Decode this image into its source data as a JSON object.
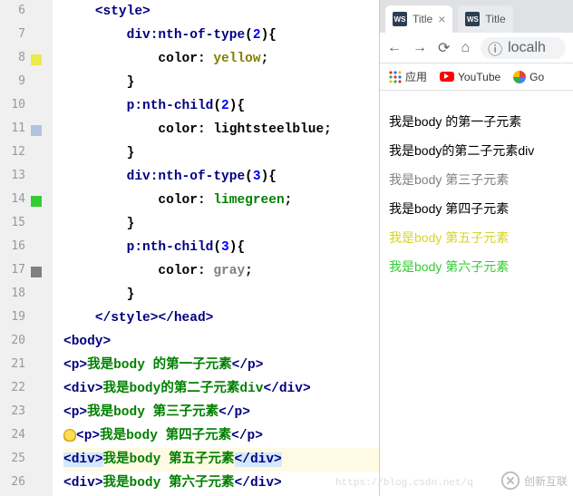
{
  "editor": {
    "line_numbers": [
      "6",
      "7",
      "8",
      "9",
      "10",
      "11",
      "12",
      "13",
      "14",
      "15",
      "16",
      "17",
      "18",
      "19",
      "20",
      "21",
      "22",
      "23",
      "24",
      "25",
      "26"
    ],
    "gutter_marks": [
      {
        "line": "8",
        "color": "#eaea4a"
      },
      {
        "line": "11",
        "color": "#b0c4de"
      },
      {
        "line": "14",
        "color": "#32cd32"
      },
      {
        "line": "17",
        "color": "#808080"
      }
    ],
    "lines": {
      "6": {
        "indent": 2,
        "tokens": [
          {
            "t": "<",
            "c": "tag"
          },
          {
            "t": "style",
            "c": "tag"
          },
          {
            "t": ">",
            "c": "tag"
          }
        ]
      },
      "7": {
        "indent": 4,
        "tokens": [
          {
            "t": "div:nth-of-type",
            "c": "sel"
          },
          {
            "t": "(",
            "c": "punct"
          },
          {
            "t": "2",
            "c": "num"
          },
          {
            "t": ")",
            "c": "punct"
          },
          {
            "t": "{",
            "c": "punct"
          }
        ]
      },
      "8": {
        "indent": 6,
        "tokens": [
          {
            "t": "color",
            "c": "prop"
          },
          {
            "t": ": ",
            "c": "punct"
          },
          {
            "t": "yellow",
            "c": "val-yellow"
          },
          {
            "t": ";",
            "c": "punct"
          }
        ]
      },
      "9": {
        "indent": 4,
        "tokens": [
          {
            "t": "}",
            "c": "punct"
          }
        ]
      },
      "10": {
        "indent": 4,
        "tokens": [
          {
            "t": "p:nth-child",
            "c": "sel"
          },
          {
            "t": "(",
            "c": "punct"
          },
          {
            "t": "2",
            "c": "num"
          },
          {
            "t": ")",
            "c": "punct"
          },
          {
            "t": "{",
            "c": "punct"
          }
        ]
      },
      "11": {
        "indent": 6,
        "tokens": [
          {
            "t": "color",
            "c": "prop"
          },
          {
            "t": ": ",
            "c": "punct"
          },
          {
            "t": "lightsteelblue",
            "c": "val-lsb"
          },
          {
            "t": ";",
            "c": "punct"
          }
        ]
      },
      "12": {
        "indent": 4,
        "tokens": [
          {
            "t": "}",
            "c": "punct"
          }
        ]
      },
      "13": {
        "indent": 4,
        "tokens": [
          {
            "t": "div:nth-of-type",
            "c": "sel"
          },
          {
            "t": "(",
            "c": "punct"
          },
          {
            "t": "3",
            "c": "num"
          },
          {
            "t": ")",
            "c": "punct"
          },
          {
            "t": "{",
            "c": "punct"
          }
        ]
      },
      "14": {
        "indent": 6,
        "tokens": [
          {
            "t": "color",
            "c": "prop"
          },
          {
            "t": ": ",
            "c": "punct"
          },
          {
            "t": "limegreen",
            "c": "val-lime"
          },
          {
            "t": ";",
            "c": "punct"
          }
        ]
      },
      "15": {
        "indent": 4,
        "tokens": [
          {
            "t": "}",
            "c": "punct"
          }
        ]
      },
      "16": {
        "indent": 4,
        "tokens": [
          {
            "t": "p:nth-child",
            "c": "sel"
          },
          {
            "t": "(",
            "c": "punct"
          },
          {
            "t": "3",
            "c": "num"
          },
          {
            "t": ")",
            "c": "punct"
          },
          {
            "t": "{",
            "c": "punct"
          }
        ]
      },
      "17": {
        "indent": 6,
        "tokens": [
          {
            "t": "color",
            "c": "prop"
          },
          {
            "t": ": ",
            "c": "punct"
          },
          {
            "t": "gray",
            "c": "val-gray"
          },
          {
            "t": ";",
            "c": "punct"
          }
        ]
      },
      "18": {
        "indent": 4,
        "tokens": [
          {
            "t": "}",
            "c": "punct"
          }
        ]
      },
      "19": {
        "indent": 2,
        "tokens": [
          {
            "t": "</",
            "c": "tag"
          },
          {
            "t": "style",
            "c": "tag"
          },
          {
            "t": ">",
            "c": "tag"
          },
          {
            "t": "</",
            "c": "tag"
          },
          {
            "t": "head",
            "c": "tag"
          },
          {
            "t": ">",
            "c": "tag"
          }
        ]
      },
      "20": {
        "indent": 0,
        "tokens": [
          {
            "t": "<",
            "c": "tag"
          },
          {
            "t": "body",
            "c": "tag"
          },
          {
            "t": ">",
            "c": "tag"
          }
        ]
      },
      "21": {
        "indent": 0,
        "tokens": [
          {
            "t": "<",
            "c": "tag"
          },
          {
            "t": "p",
            "c": "tag"
          },
          {
            "t": ">",
            "c": "tag"
          },
          {
            "t": "我是body 的第一子元素",
            "c": "str"
          },
          {
            "t": "</",
            "c": "tag"
          },
          {
            "t": "p",
            "c": "tag"
          },
          {
            "t": ">",
            "c": "tag"
          }
        ]
      },
      "22": {
        "indent": 0,
        "tokens": [
          {
            "t": "<",
            "c": "tag"
          },
          {
            "t": "div",
            "c": "tag"
          },
          {
            "t": ">",
            "c": "tag"
          },
          {
            "t": "我是body的第二子元素div",
            "c": "str"
          },
          {
            "t": "</",
            "c": "tag"
          },
          {
            "t": "div",
            "c": "tag"
          },
          {
            "t": ">",
            "c": "tag"
          }
        ]
      },
      "23": {
        "indent": 0,
        "tokens": [
          {
            "t": "<",
            "c": "tag"
          },
          {
            "t": "p",
            "c": "tag"
          },
          {
            "t": ">",
            "c": "tag"
          },
          {
            "t": "我是body 第三子元素",
            "c": "str"
          },
          {
            "t": "</",
            "c": "tag"
          },
          {
            "t": "p",
            "c": "tag"
          },
          {
            "t": ">",
            "c": "tag"
          }
        ]
      },
      "24": {
        "indent": 0,
        "bulb": true,
        "tokens": [
          {
            "t": "<",
            "c": "tag"
          },
          {
            "t": "p",
            "c": "tag"
          },
          {
            "t": ">",
            "c": "tag"
          },
          {
            "t": "我是body 第四子元素",
            "c": "str"
          },
          {
            "t": "</",
            "c": "tag"
          },
          {
            "t": "p",
            "c": "tag"
          },
          {
            "t": ">",
            "c": "tag"
          }
        ]
      },
      "25": {
        "indent": 0,
        "hl": true,
        "tokens": [
          {
            "t": "<",
            "c": "tag hl-tag"
          },
          {
            "t": "div",
            "c": "tag hl-tag"
          },
          {
            "t": ">",
            "c": "tag hl-tag"
          },
          {
            "t": "我是body 第五子元素",
            "c": "str"
          },
          {
            "t": "</",
            "c": "tag hl-tag"
          },
          {
            "t": "div",
            "c": "tag hl-tag"
          },
          {
            "t": ">",
            "c": "tag hl-tag"
          }
        ]
      },
      "26": {
        "indent": 0,
        "tokens": [
          {
            "t": "<",
            "c": "tag"
          },
          {
            "t": "div",
            "c": "tag"
          },
          {
            "t": ">",
            "c": "tag"
          },
          {
            "t": "我是body 第六子元素",
            "c": "str"
          },
          {
            "t": "</",
            "c": "tag"
          },
          {
            "t": "div",
            "c": "tag"
          },
          {
            "t": ">",
            "c": "tag"
          }
        ]
      }
    }
  },
  "browser": {
    "tabs": [
      {
        "icon": "WS",
        "title": "Title",
        "active": true
      },
      {
        "icon": "WS",
        "title": "Title",
        "active": false
      }
    ],
    "navigation": {
      "url_text": "localh"
    },
    "bookmarks": {
      "apps": "应用",
      "youtube": "YouTube",
      "google": "Go"
    },
    "page_lines": [
      {
        "text": "我是body 的第一子元素",
        "color": "#000000"
      },
      {
        "text": "我是body的第二子元素div",
        "color": "#000000"
      },
      {
        "text": "我是body 第三子元素",
        "color": "#808080"
      },
      {
        "text": "我是body 第四子元素",
        "color": "#000000"
      },
      {
        "text": "我是body 第五子元素",
        "color": "#d4d42a"
      },
      {
        "text": "我是body 第六子元素",
        "color": "#32cd32"
      }
    ]
  },
  "watermark": {
    "logo": "创新互联",
    "url": "https://blog.csdn.net/q"
  }
}
